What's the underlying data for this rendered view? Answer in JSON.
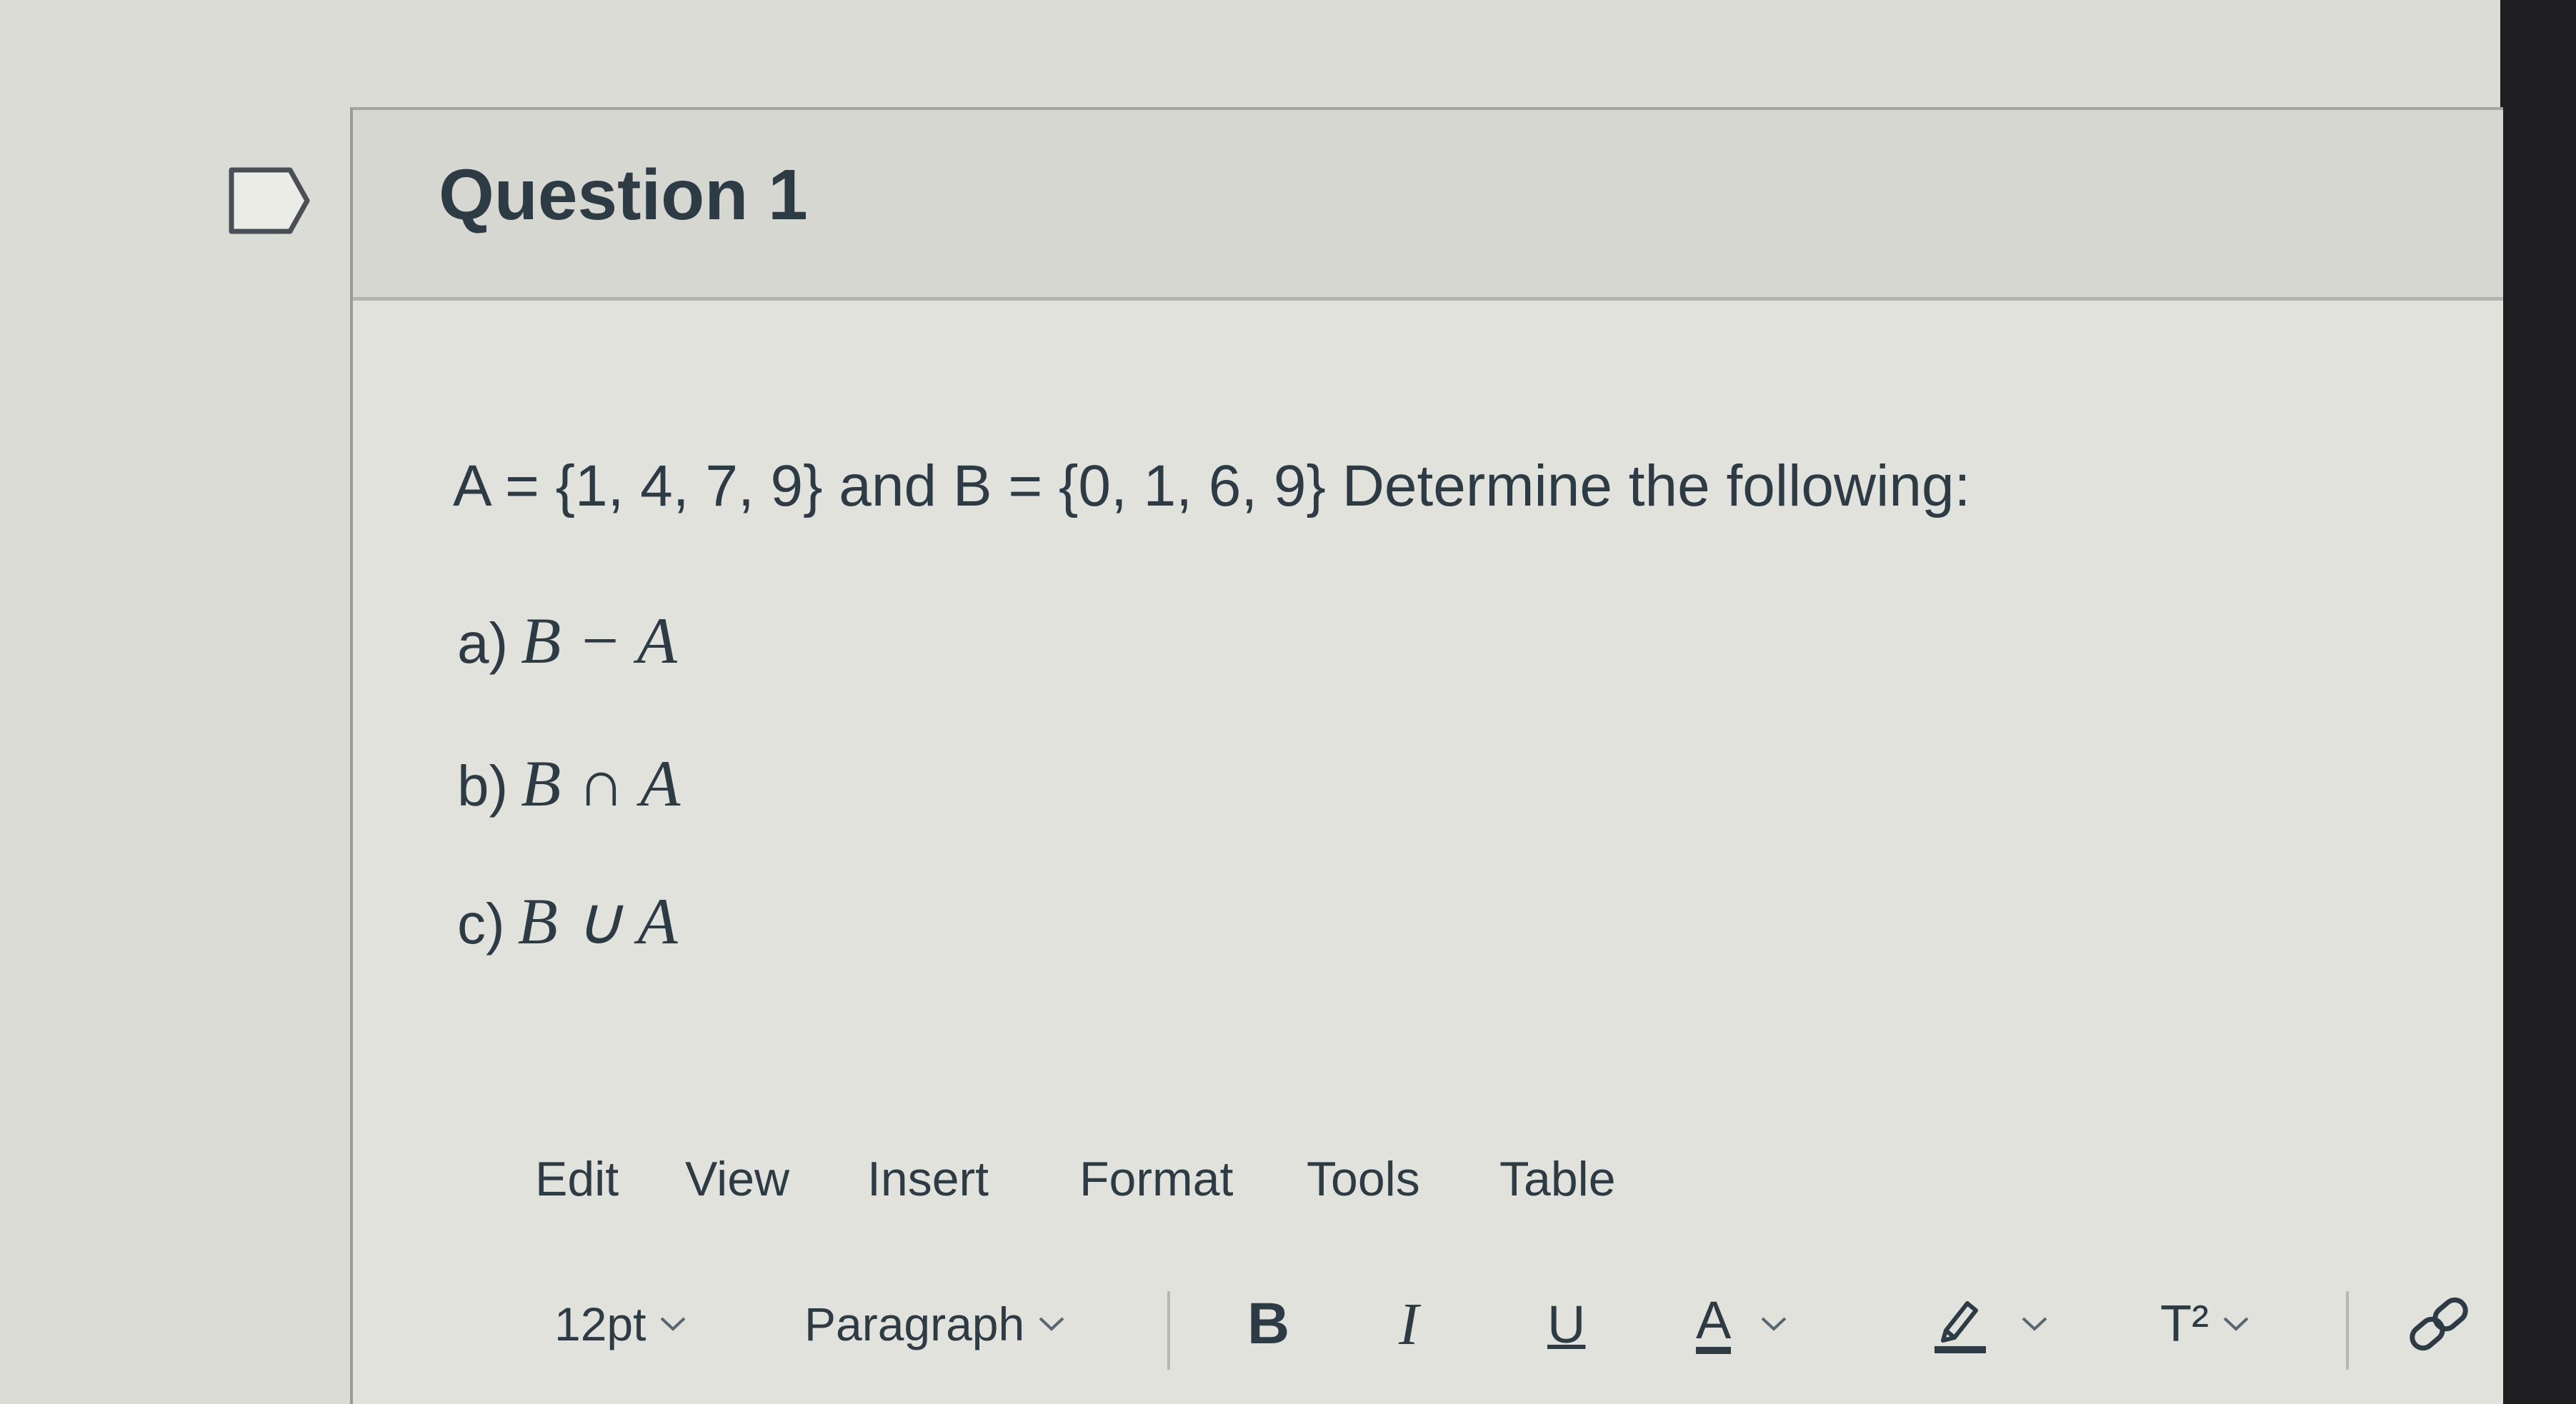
{
  "question": {
    "title": "Question 1",
    "prompt": "A = {1, 4, 7, 9} and B = {0, 1, 6, 9}  Determine the following:",
    "parts": [
      {
        "prefix": "a)",
        "expression": "B − A"
      },
      {
        "prefix": "b)",
        "expression": "B ∩ A"
      },
      {
        "prefix": "c)",
        "expression": "B ∪ A"
      }
    ]
  },
  "editor": {
    "menu": [
      "Edit",
      "View",
      "Insert",
      "Format",
      "Tools",
      "Table"
    ],
    "toolbar": {
      "font_size": "12pt",
      "block_format": "Paragraph",
      "bold_label": "B",
      "italic_label": "I",
      "underline_label": "U",
      "text_color_label": "A",
      "superscript_label": "T²"
    }
  },
  "colors": {
    "text": "#2d3b45",
    "page_background": "#dcdcd6",
    "right_edge": "#1f1f21"
  },
  "icons": [
    "flag-icon",
    "chevron-down-icon",
    "highlighter-icon",
    "link-icon"
  ]
}
